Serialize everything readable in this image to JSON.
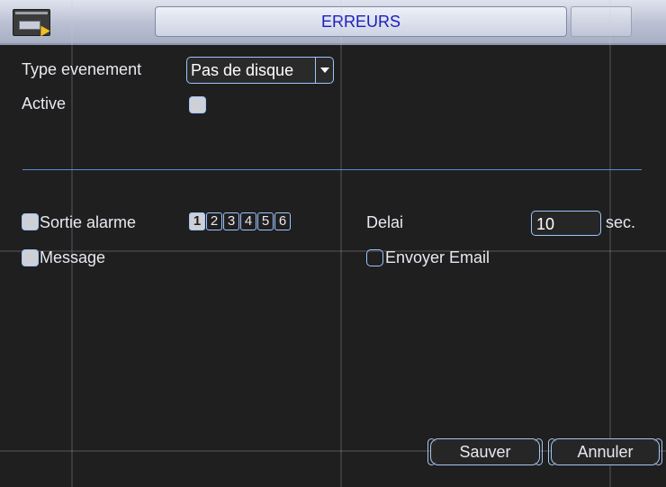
{
  "window": {
    "title": "ERREURS"
  },
  "form": {
    "event_type": {
      "label": "Type evenement",
      "value": "Pas de disque"
    },
    "active": {
      "label": "Active",
      "checked": false
    },
    "alarm_output": {
      "label": "Sortie alarme",
      "checked": false,
      "channels": [
        "1",
        "2",
        "3",
        "4",
        "5",
        "6"
      ],
      "selected": [
        "1"
      ]
    },
    "delay": {
      "label": "Delai",
      "value": "10",
      "unit": "sec."
    },
    "message": {
      "label": "Message",
      "checked": false
    },
    "send_email": {
      "label": "Envoyer Email",
      "checked": false
    }
  },
  "buttons": {
    "save": "Sauver",
    "cancel": "Annuler"
  },
  "colors": {
    "accent": "#9ec4ff",
    "title_text": "#1a1dbf",
    "background": "#1f1f1f"
  }
}
